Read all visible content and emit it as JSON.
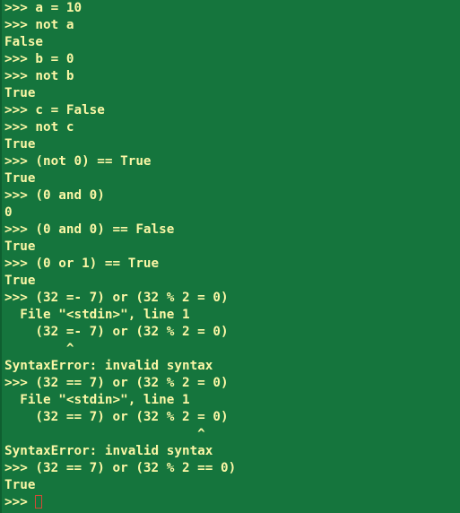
{
  "terminal": {
    "theme": {
      "background": "#15753d",
      "foreground": "#fbf7a6",
      "cursor": "#d24a36"
    },
    "lines": [
      ">>> a = 10",
      ">>> not a",
      "False",
      ">>> b = 0",
      ">>> not b",
      "True",
      ">>> c = False",
      ">>> not c",
      "True",
      ">>> (not 0) == True",
      "True",
      ">>> (0 and 0)",
      "0",
      ">>> (0 and 0) == False",
      "True",
      ">>> (0 or 1) == True",
      "True",
      ">>> (32 =- 7) or (32 % 2 = 0)",
      "  File \"<stdin>\", line 1",
      "    (32 =- 7) or (32 % 2 = 0)",
      "        ^",
      "SyntaxError: invalid syntax",
      ">>> (32 == 7) or (32 % 2 = 0)",
      "  File \"<stdin>\", line 1",
      "    (32 == 7) or (32 % 2 = 0)",
      "                         ^",
      "SyntaxError: invalid syntax",
      ">>> (32 == 7) or (32 % 2 == 0)",
      "True",
      ">>> "
    ]
  }
}
